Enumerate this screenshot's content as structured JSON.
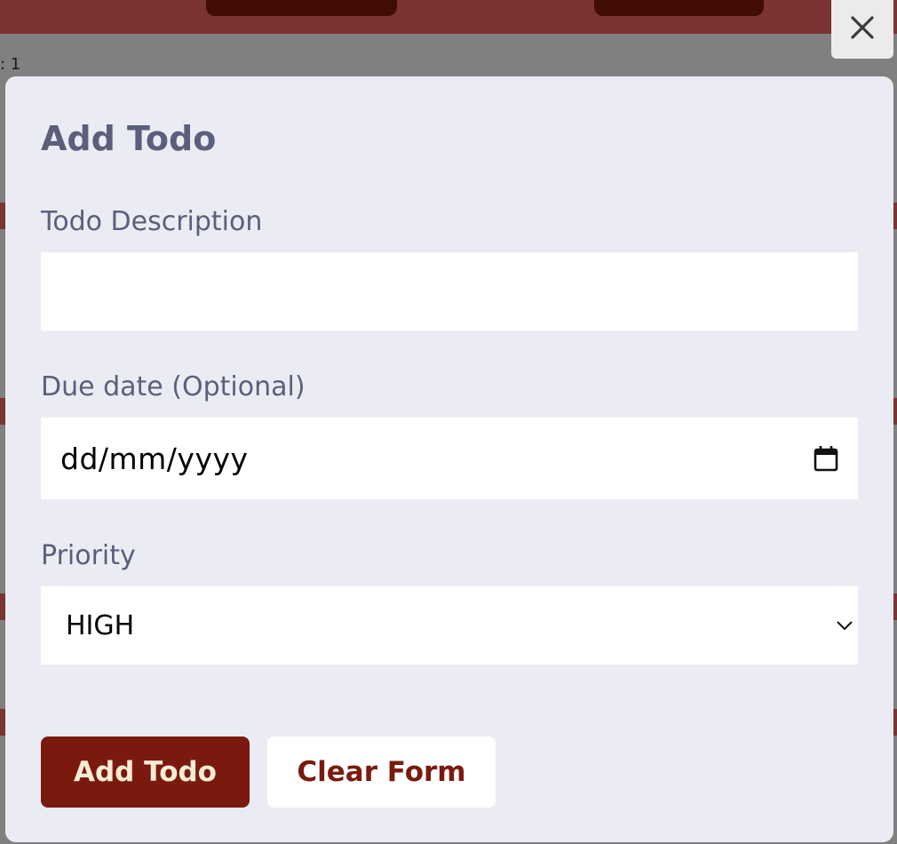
{
  "modal": {
    "title": "Add Todo",
    "description_label": "Todo Description",
    "description_value": "",
    "due_date_label": "Due date (Optional)",
    "due_date_placeholder": "dd/mm/yyyy",
    "priority_label": "Priority",
    "priority_selected": "HIGH",
    "add_button": "Add Todo",
    "clear_button": "Clear Form",
    "close_icon": "close-icon"
  },
  "background": {
    "snippets": [
      ": 1"
    ]
  },
  "colors": {
    "header": "#7b3431",
    "overlay": "#808080",
    "modal_bg": "#ebecf3",
    "label_text": "#5b5f7b",
    "primary_button": "#7a1a0f",
    "primary_button_text": "#f7ecd4"
  }
}
